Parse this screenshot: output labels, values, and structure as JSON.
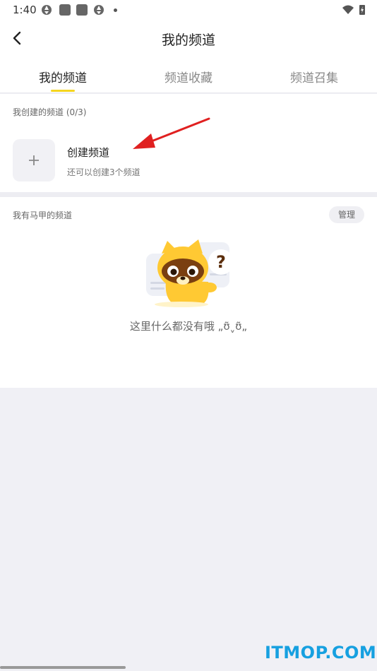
{
  "status_bar": {
    "time": "1:40"
  },
  "header": {
    "title": "我的频道"
  },
  "tabs": [
    {
      "label": "我的频道",
      "active": true
    },
    {
      "label": "频道收藏",
      "active": false
    },
    {
      "label": "频道召集",
      "active": false
    }
  ],
  "created_section": {
    "label": "我创建的频道 (0/3)",
    "create_title": "创建频道",
    "create_sub": "还可以创建3个频道"
  },
  "alias_section": {
    "label": "我有马甲的频道",
    "manage_label": "管理",
    "empty_text": "这里什么都没有哦 „ʊ̃ˬʊ̃„"
  },
  "watermark": "ITMOP.COM",
  "colors": {
    "accent": "#f5d520",
    "annotation_arrow": "#e02020",
    "watermark": "#16a0e0"
  }
}
